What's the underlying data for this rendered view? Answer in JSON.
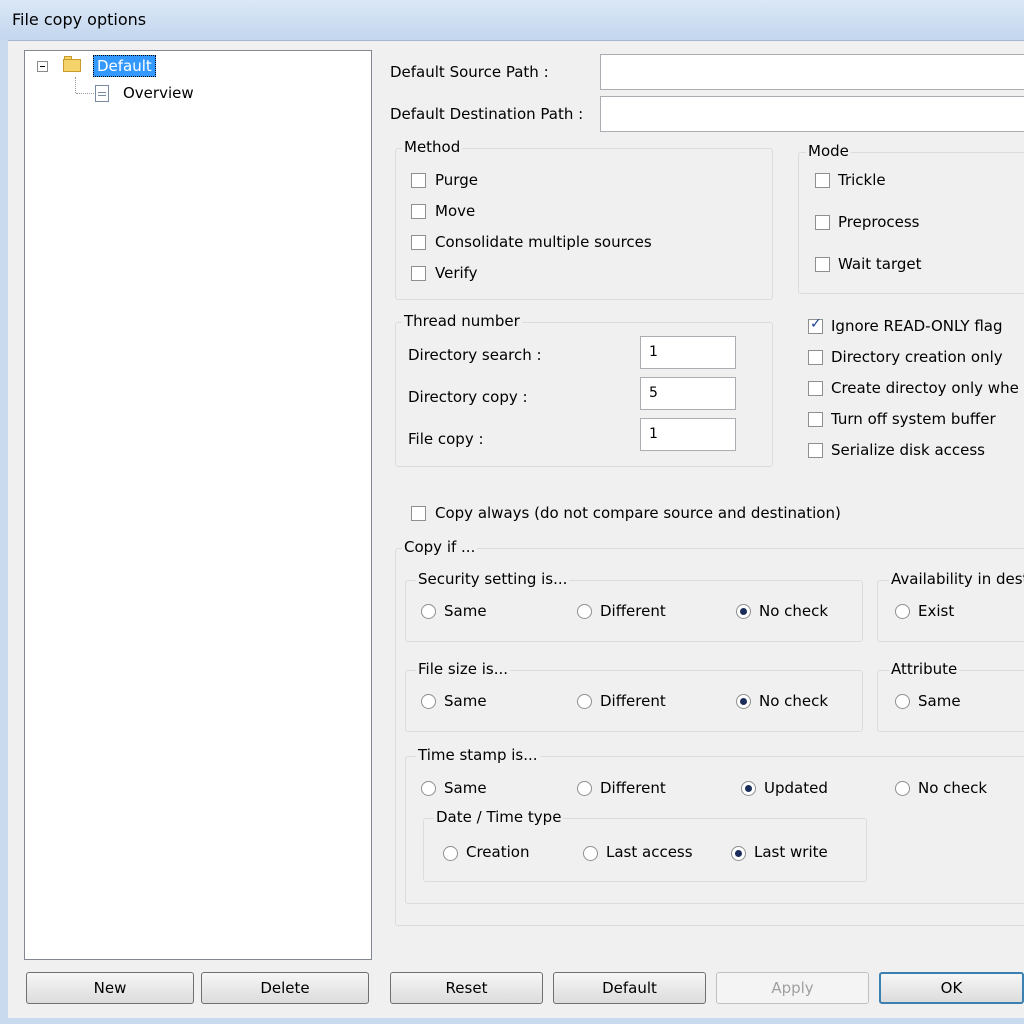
{
  "window": {
    "title": "File copy options"
  },
  "tree": {
    "root": "Default",
    "child": "Overview"
  },
  "paths": {
    "source_label": "Default Source Path :",
    "source_value": "",
    "dest_label": "Default Destination Path :",
    "dest_value": ""
  },
  "method": {
    "title": "Method",
    "purge": "Purge",
    "move": "Move",
    "consolidate": "Consolidate multiple sources",
    "verify": "Verify"
  },
  "mode": {
    "title": "Mode",
    "trickle": "Trickle",
    "preprocess": "Preprocess",
    "wait_target": "Wait target"
  },
  "threads": {
    "title": "Thread number",
    "dir_search_label": "Directory search :",
    "dir_search_value": "1",
    "dir_copy_label": "Directory copy :",
    "dir_copy_value": "5",
    "file_copy_label": "File copy :",
    "file_copy_value": "1"
  },
  "options": {
    "ignore_readonly": "Ignore READ-ONLY flag",
    "dir_creation_only": "Directory creation only",
    "create_dir_only_when": "Create directoy only whe",
    "turn_off_buffer": "Turn off system buffer",
    "serialize_disk": "Serialize disk access"
  },
  "copy_always": "Copy always (do not compare source and destination)",
  "copy_if": {
    "title": "Copy if ...",
    "security": {
      "title": "Security setting is...",
      "same": "Same",
      "different": "Different",
      "nocheck": "No check"
    },
    "availability": {
      "title": "Availability in dest",
      "exist": "Exist"
    },
    "filesize": {
      "title": "File size is...",
      "same": "Same",
      "different": "Different",
      "nocheck": "No check"
    },
    "attribute": {
      "title": "Attribute",
      "same": "Same"
    },
    "timestamp": {
      "title": "Time stamp is...",
      "same": "Same",
      "different": "Different",
      "updated": "Updated",
      "nocheck": "No check",
      "datetype": {
        "title": "Date / Time type",
        "creation": "Creation",
        "last_access": "Last access",
        "last_write": "Last write"
      }
    }
  },
  "buttons": {
    "new": "New",
    "delete": "Delete",
    "reset": "Reset",
    "default": "Default",
    "apply": "Apply",
    "ok": "OK"
  }
}
